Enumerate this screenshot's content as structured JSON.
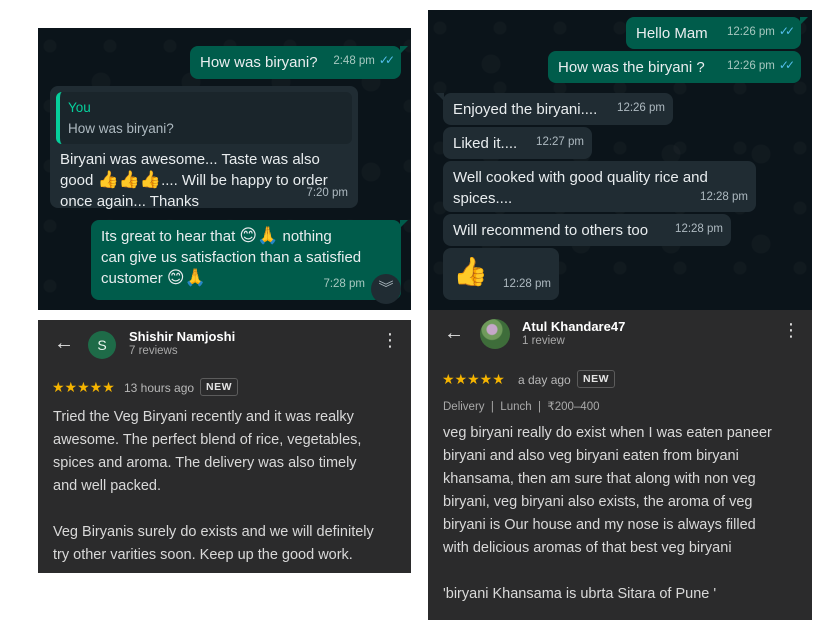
{
  "chat_left": {
    "messages": [
      {
        "text": "How was biryani?",
        "time": "2:48 pm",
        "ticks": "✓✓"
      },
      {
        "quote_author": "You",
        "quote_text": "How was biryani?",
        "text_a": "Biryani was awesome... Taste was also",
        "text_b_pre": "good ",
        "text_b_post": ".... Will be happy to order",
        "text_c": "once again... Thanks",
        "time": "7:20 pm"
      },
      {
        "text_a_pre": "Its great to hear that ",
        "text_a_post": " nothing",
        "text_b": "can give us satisfaction than a satisfied",
        "text_c": "customer ",
        "time": "7:28 pm"
      }
    ]
  },
  "chat_right": {
    "messages": [
      {
        "text": "Hello Mam",
        "time": "12:26 pm",
        "ticks": "✓✓"
      },
      {
        "text": "How was the biryani ?",
        "time": "12:26 pm",
        "ticks": "✓✓"
      },
      {
        "text": "Enjoyed the biryani....",
        "time": "12:26 pm"
      },
      {
        "text": "Liked it....",
        "time": "12:27 pm"
      },
      {
        "text_a": "Well cooked with good quality rice and",
        "text_b": "spices....",
        "time": "12:28 pm"
      },
      {
        "text": "Will recommend to others too",
        "time": "12:28 pm"
      },
      {
        "time": "12:28 pm"
      }
    ]
  },
  "review_left": {
    "avatar_letter": "S",
    "avatar_color": "#1e6b48",
    "name": "Shishir Namjoshi",
    "reviews": "7 reviews",
    "stars": "★★★★★",
    "rating": 5,
    "ago": "13 hours ago",
    "badge": "NEW",
    "lines": [
      "Tried the Veg Biryani recently and it was realky",
      "awesome. The perfect blend of rice, vegetables,",
      "spices and aroma. The delivery was also timely",
      "and well packed.",
      "",
      "Veg Biryanis surely do exists and we will definitely",
      "try other varities soon. Keep up the good work."
    ]
  },
  "review_right": {
    "name": "Atul Khandare47",
    "reviews": "1 review",
    "stars": "★★★★★",
    "rating": 5,
    "ago": "a day ago",
    "badge": "NEW",
    "meta": "Delivery  |  Lunch  |  ₹200–400",
    "lines": [
      "veg biryani really do exist when I was eaten paneer",
      "biryani and also veg biryani eaten from biryani",
      "khansama, then am sure that along with non veg",
      "biryani, veg biryani also exists, the aroma of veg",
      "biryani is Our house and my nose is always filled",
      "with delicious aromas of that best veg biryani",
      "",
      "'biryani Khansama is ubrta Sitara of Pune '"
    ]
  },
  "icons": {
    "back": "arrow-left-icon",
    "more": "more-vertical-icon",
    "scroll": "chevron-double-down-icon",
    "thumbs": "thumbs-up-emoji",
    "smile": "smiling-face-emoji",
    "pray": "folded-hands-emoji"
  },
  "colors": {
    "outgoing_bubble": "#005c4b",
    "incoming_bubble": "#202c33",
    "chat_bg": "#0b141a",
    "read_ticks": "#53bdeb",
    "review_bg": "#2b2b2c",
    "stars": "#f5b400"
  }
}
